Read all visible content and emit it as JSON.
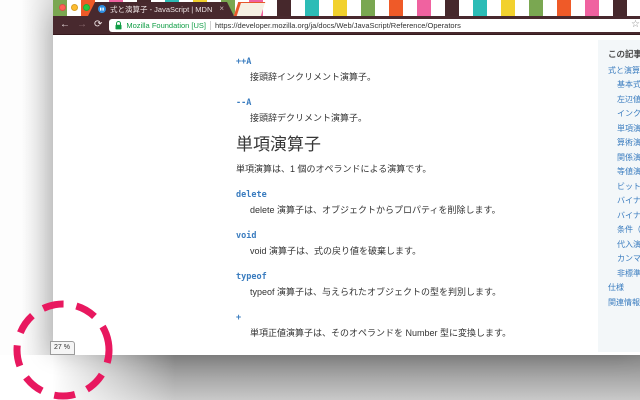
{
  "browser": {
    "tab": {
      "title": "式と演算子 - JavaScript | MDN",
      "close_label": "×"
    },
    "toolbar": {
      "back_label": "←",
      "forward_label": "→",
      "reload_label": "⟳",
      "bookmark_star_label": "☆"
    },
    "address_bar": {
      "security_label": "Mozilla Foundation [US]",
      "url": "https://developer.mozilla.org/ja/docs/Web/JavaScript/Reference/Operators"
    },
    "traffic_lights": [
      "#ff5f57",
      "#febc2e",
      "#28c840"
    ],
    "theme_stripes": [
      "#7aa751",
      "#ffffff",
      "#ef5a28",
      "#ffffff",
      "#f062a0",
      "#ffffff",
      "#46282c",
      "#ffffff",
      "#2cbcb6",
      "#ffffff",
      "#f2d12e",
      "#ffffff",
      "#7aa751",
      "#ffffff",
      "#f062a0",
      "#ffffff",
      "#46282c",
      "#ffffff",
      "#2cbcb6",
      "#ffffff",
      "#f2d12e",
      "#ffffff",
      "#7aa751",
      "#ffffff",
      "#ef5a28",
      "#ffffff",
      "#f062a0",
      "#ffffff",
      "#46282c",
      "#ffffff",
      "#2cbcb6",
      "#ffffff",
      "#f2d12e",
      "#ffffff",
      "#7aa751",
      "#ffffff",
      "#ef5a28",
      "#ffffff",
      "#f062a0",
      "#ffffff",
      "#46282c",
      "#ffffff",
      "#2cbcb6",
      "#ffffff",
      "#f2d12e",
      "#ffffff"
    ]
  },
  "content": {
    "section1": [
      {
        "term": "++A",
        "desc": "接頭辞インクリメント演算子。"
      },
      {
        "term": "--A",
        "desc": "接頭辞デクリメント演算子。"
      }
    ],
    "heading": "単項演算子",
    "intro": "単項演算は、1 個のオペランドによる演算です。",
    "section2": [
      {
        "term": "delete",
        "desc": "delete 演算子は、オブジェクトからプロパティを削除します。"
      },
      {
        "term": "void",
        "desc": "void 演算子は、式の戻り値を破棄します。"
      },
      {
        "term": "typeof",
        "desc": "typeof 演算子は、与えられたオブジェクトの型を判別します。"
      },
      {
        "term": "+",
        "desc": "単項正値演算子は、そのオペランドを Number 型に変換します。"
      },
      {
        "term": "-",
        "desc": ""
      }
    ]
  },
  "sidebar": {
    "heading": "この記事では",
    "items": [
      {
        "label": "式と演算子",
        "indent": false
      },
      {
        "label": "基本式",
        "indent": true
      },
      {
        "label": "左辺値式",
        "indent": true
      },
      {
        "label": "インクリメントとデクリメント",
        "indent": true
      },
      {
        "label": "単項演算子",
        "indent": true
      },
      {
        "label": "算術演算子",
        "indent": true
      },
      {
        "label": "関係演算子",
        "indent": true
      },
      {
        "label": "等値演算子",
        "indent": true
      },
      {
        "label": "ビットシフト演算子",
        "indent": true
      },
      {
        "label": "バイナリビット演算子",
        "indent": true
      },
      {
        "label": "バイナリ論理演算子",
        "indent": true
      },
      {
        "label": "条件（三項）演算子",
        "indent": true
      },
      {
        "label": "代入演算子",
        "indent": true
      },
      {
        "label": "カンマ演算子",
        "indent": true
      },
      {
        "label": "非標準の機能",
        "indent": true
      },
      {
        "label": "仕様",
        "indent": false
      },
      {
        "label": "関連情報",
        "indent": false
      }
    ]
  },
  "zoom_indicator": {
    "label": "27 %"
  },
  "annotation": {
    "color": "#e8185f"
  }
}
